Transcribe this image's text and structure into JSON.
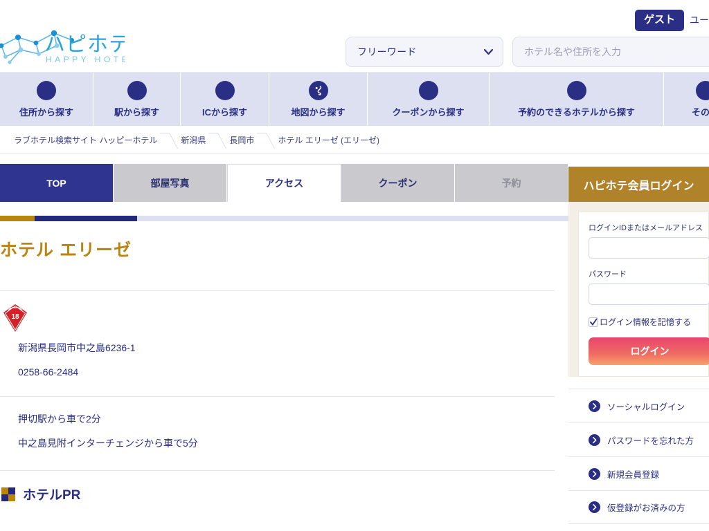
{
  "header": {
    "logo_main": "ハピホテ",
    "logo_sub": "HAPPY HOTEL",
    "guest_badge": "ゲスト",
    "guest_user_text": "ユー",
    "search_select_value": "フリーワード",
    "search_input_placeholder": "ホテル名や住所を入力",
    "search_input_value": ""
  },
  "global_nav": [
    {
      "label": "住所から探す",
      "icon": "circle-icon"
    },
    {
      "label": "駅から探す",
      "icon": "circle-icon"
    },
    {
      "label": "ICから探す",
      "icon": "circle-icon"
    },
    {
      "label": "地図から探す",
      "icon": "map-japan-icon"
    },
    {
      "label": "クーポンから探す",
      "icon": "circle-icon"
    },
    {
      "label": "予約のできるホテルから探す",
      "icon": "circle-icon"
    },
    {
      "label": "その他",
      "icon": "circle-icon"
    }
  ],
  "breadcrumbs": [
    "ラブホテル検索サイト ハッピーホテル",
    "新潟県",
    "長岡市",
    "ホテル エリーゼ (エリーゼ)"
  ],
  "tabs": [
    {
      "label": "TOP",
      "state": "top"
    },
    {
      "label": "部屋写真",
      "state": "normal"
    },
    {
      "label": "アクセス",
      "state": "current"
    },
    {
      "label": "クーポン",
      "state": "normal"
    },
    {
      "label": "予約",
      "state": "disabled"
    }
  ],
  "hotel": {
    "name": "ホテル エリーゼ",
    "address": "新潟県長岡市中之島6236-1",
    "tel": "0258-66-2484",
    "access_1": "押切駅から車で2分",
    "access_2": "中之島見附インターチェンジから車で5分",
    "age_badge": "18",
    "pr_heading": "ホテルPR"
  },
  "login_panel": {
    "title": "ハピホテ会員ログイン",
    "id_label": "ログインIDまたはメールアドレス",
    "id_value": "",
    "password_label": "パスワード",
    "password_value": "",
    "remember_label": "ログイン情報を記憶する",
    "login_button": "ログイン",
    "links": [
      "ソーシャルログイン",
      "パスワードを忘れた方",
      "新規会員登録",
      "仮登録がお済みの方"
    ]
  },
  "colors": {
    "navy": "#2a2f85",
    "gold": "#b08229",
    "lavender": "#dde0f0",
    "pink": "#e8446e",
    "red_badge": "#d42028"
  }
}
